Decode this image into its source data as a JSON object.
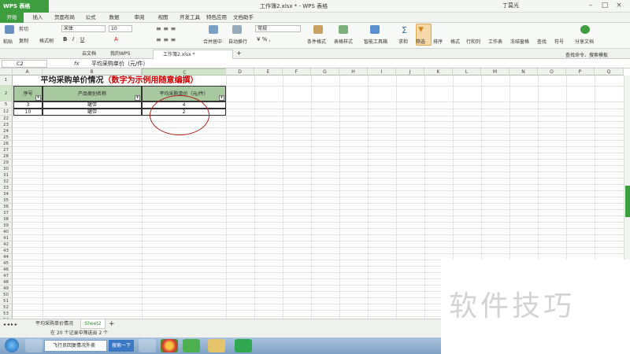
{
  "app": {
    "button": "WPS 表格",
    "doc_title": "工作簿2.xlsx * - WPS 表格",
    "user": "丁莫光"
  },
  "menu": [
    "开始",
    "插入",
    "页面布局",
    "公式",
    "数据",
    "审阅",
    "视图",
    "开发工具",
    "特色应用",
    "文档助手"
  ],
  "ribbon": {
    "paste": "粘贴",
    "cut": "剪切",
    "copy": "复制",
    "format_painter": "格式刷",
    "font": "宋体",
    "size": "10",
    "number_format": "常规",
    "merge": "合并居中",
    "wrap": "自动换行",
    "cond_format": "条件格式",
    "table_style": "表格样式",
    "smart_toolbox": "智能工具箱",
    "sum": "求和",
    "filter": "筛选",
    "sort": "排序",
    "format": "格式",
    "row_col": "行和列",
    "worksheet": "工作表",
    "freeze": "冻结窗格",
    "find": "查找",
    "symbol": "符号",
    "share": "分享文档",
    "search_box": "查找命令、搜索模板"
  },
  "doctabs": [
    "云文档",
    "我的WPS",
    "工作簿2.xlsx *"
  ],
  "formula": {
    "cell_ref": "C2",
    "fx": "fx",
    "content": "平均采购单价（元/件）"
  },
  "columns": [
    "A",
    "B",
    "C",
    "D",
    "E",
    "F",
    "G",
    "H",
    "I",
    "J",
    "K",
    "L",
    "M",
    "N",
    "O",
    "P",
    "Q"
  ],
  "rows": [
    "1",
    "2",
    "5",
    "12",
    "22",
    "23",
    "24",
    "25",
    "26",
    "27",
    "28",
    "29",
    "30",
    "31",
    "32",
    "33",
    "34",
    "35",
    "36",
    "37",
    "38",
    "39",
    "40",
    "41",
    "42",
    "43",
    "44",
    "45",
    "46",
    "47",
    "48",
    "49",
    "50",
    "51",
    "52",
    "53",
    "54",
    "55",
    "56"
  ],
  "sheet": {
    "title_main": "平均采购单价情况",
    "title_note": "（数字为示例用随意编撰）",
    "headers": [
      "序号",
      "产品类别名称",
      "平均采购单价（元/件）"
    ],
    "data": [
      [
        "3",
        "罐带",
        "4"
      ],
      [
        "10",
        "罐带",
        "2"
      ]
    ],
    "header_color": "#a8c8a0",
    "circle_color": "#b02020"
  },
  "sheets": [
    "平均采购单价情况",
    "Sheet2"
  ],
  "status": "在 20 个记录中筛选出 2 个",
  "taskbar": {
    "search": "飞行员回复情况外卖",
    "search_btn": "搜索一下"
  },
  "watermark": "软件技巧"
}
